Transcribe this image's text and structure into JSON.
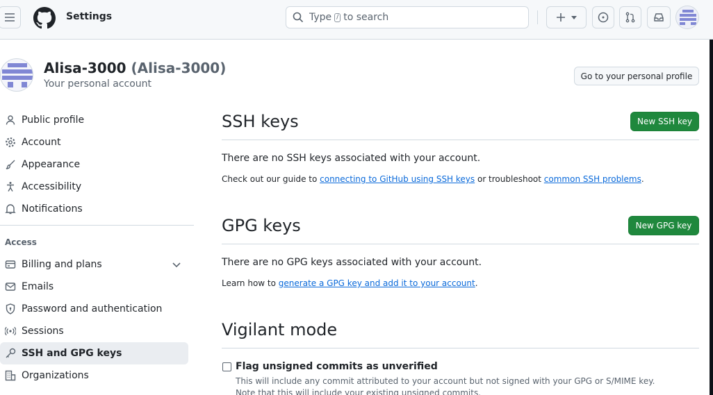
{
  "header": {
    "title": "Settings",
    "search": {
      "before": "Type",
      "key": "/",
      "after": "to search"
    }
  },
  "account": {
    "display_name": "Alisa-3000",
    "login": "(Alisa-3000)",
    "subtitle": "Your personal account",
    "profile_button": "Go to your personal profile"
  },
  "sidebar": {
    "items": [
      {
        "label": "Public profile",
        "icon": "person-icon"
      },
      {
        "label": "Account",
        "icon": "gear-icon"
      },
      {
        "label": "Appearance",
        "icon": "paintbrush-icon"
      },
      {
        "label": "Accessibility",
        "icon": "accessibility-icon"
      },
      {
        "label": "Notifications",
        "icon": "bell-icon"
      }
    ],
    "group_label": "Access",
    "access_items": [
      {
        "label": "Billing and plans",
        "icon": "credit-card-icon"
      },
      {
        "label": "Emails",
        "icon": "mail-icon"
      },
      {
        "label": "Password and authentication",
        "icon": "shield-lock-icon"
      },
      {
        "label": "Sessions",
        "icon": "broadcast-icon"
      },
      {
        "label": "SSH and GPG keys",
        "icon": "key-icon",
        "active": true
      },
      {
        "label": "Organizations",
        "icon": "organization-icon"
      }
    ]
  },
  "ssh": {
    "title": "SSH keys",
    "button": "New SSH key",
    "empty": "There are no SSH keys associated with your account.",
    "guide_before": "Check out our guide to ",
    "guide_link1": "connecting to GitHub using SSH keys",
    "guide_middle": " or troubleshoot ",
    "guide_link2": "common SSH problems",
    "guide_after": "."
  },
  "gpg": {
    "title": "GPG keys",
    "button": "New GPG key",
    "empty": "There are no GPG keys associated with your account.",
    "learn_before": "Learn how to ",
    "learn_link": "generate a GPG key and add it to your account",
    "learn_after": "."
  },
  "vigilant": {
    "title": "Vigilant mode",
    "checkbox_label": "Flag unsigned commits as unverified",
    "checked": false,
    "desc1": "This will include any commit attributed to your account but not signed with your GPG or S/MIME key.",
    "desc2": "Note that this will include your existing unsigned commits."
  },
  "colors": {
    "accent": "#0969da",
    "primary_button": "#1f883d",
    "avatar": "#8087d4"
  }
}
